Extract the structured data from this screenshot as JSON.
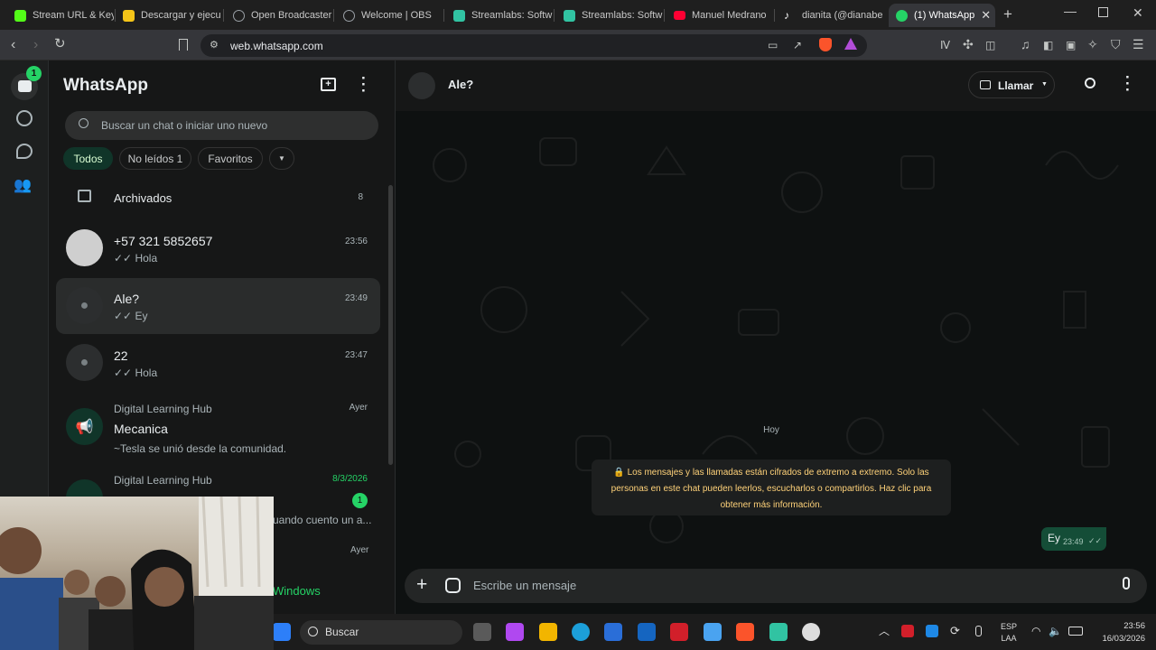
{
  "browser": {
    "tabs": [
      {
        "label": "Stream URL & Key",
        "color": "#53fc18"
      },
      {
        "label": "Descargar y ejecu",
        "color": "#f5c518"
      },
      {
        "label": "Open Broadcaster",
        "color": "#9aa0a6"
      },
      {
        "label": "Welcome | OBS",
        "color": "#9aa0a6"
      },
      {
        "label": "Streamlabs: Softw",
        "color": "#31c3a2"
      },
      {
        "label": "Streamlabs: Softw",
        "color": "#31c3a2"
      },
      {
        "label": "Manuel Medrano",
        "color": "#ff0033"
      },
      {
        "label": "dianita (@dianabe",
        "color": "#ffffff"
      },
      {
        "label": "(1) WhatsApp",
        "color": "#25d366"
      }
    ],
    "url": "web.whatsapp.com"
  },
  "sidebar": {
    "app_title": "WhatsApp",
    "chats_badge": "1",
    "search_placeholder": "Buscar un chat o iniciar uno nuevo",
    "filters": {
      "all": "Todos",
      "unread": "No leídos",
      "unread_count": "1",
      "favorites": "Favoritos"
    },
    "archived": {
      "label": "Archivados",
      "count": "8"
    },
    "chats": [
      {
        "name": "+57 321 5852657",
        "time": "23:56",
        "preview": "Hola"
      },
      {
        "name": "Ale?",
        "time": "23:49",
        "preview": "Ey"
      },
      {
        "name": "22",
        "time": "23:47",
        "preview": "Hola"
      },
      {
        "community": "Digital Learning Hub",
        "name": "Mecanica",
        "time": "Ayer",
        "preview": "~Tesla se unió desde la comunidad."
      },
      {
        "community": "Digital Learning Hub",
        "time": "8/3/2026",
        "unread": "1",
        "preview": "uando cuento un a..."
      }
    ],
    "extra_time": "Ayer",
    "windows_text": "Windows"
  },
  "chat": {
    "name": "Ale?",
    "call_label": "Llamar",
    "date_divider": "Hoy",
    "encryption_notice": "Los mensajes y las llamadas están cifrados de extremo a extremo. Solo las personas en este chat pueden leerlos, escucharlos o compartirlos. Haz clic para obtener más información.",
    "message": {
      "text": "Ey",
      "time": "23:49"
    },
    "composer_placeholder": "Escribe un mensaje"
  },
  "taskbar": {
    "search_placeholder": "Buscar",
    "lang_top": "ESP",
    "lang_bottom": "LAA",
    "clock_time": "23:56",
    "clock_date": "16/03/2026"
  },
  "colors": {
    "accent": "#25d366",
    "outgoing_bubble": "#144d37",
    "notice_text": "#ffd279"
  }
}
